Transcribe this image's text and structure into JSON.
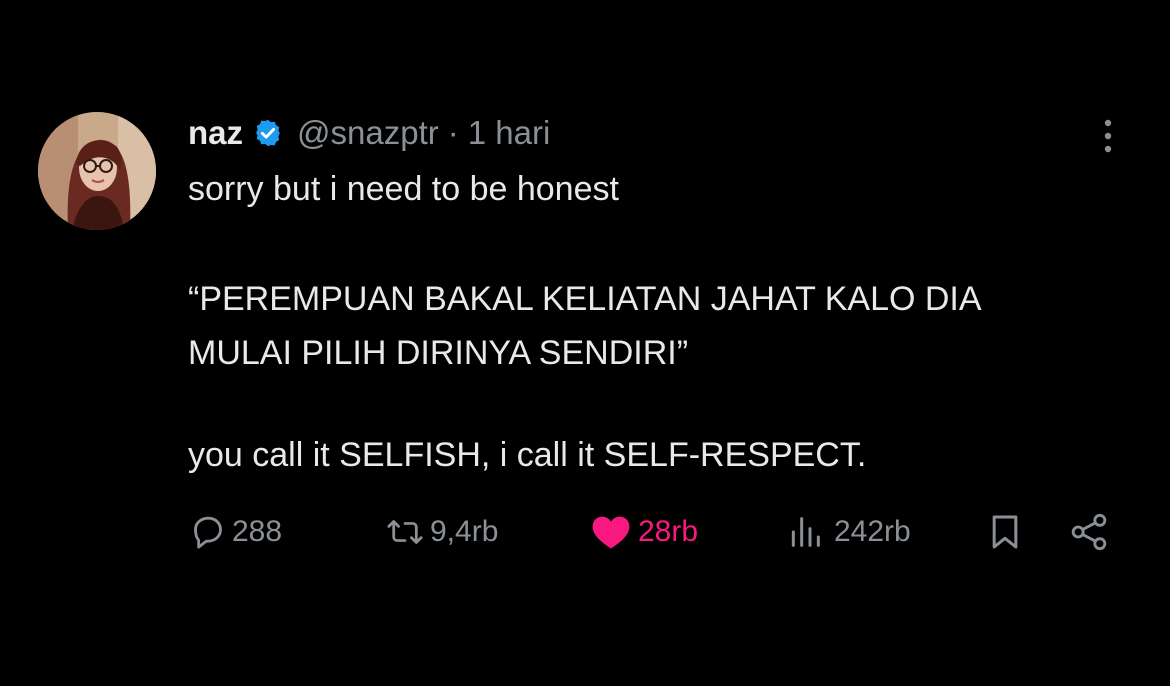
{
  "tweet": {
    "author": {
      "display_name": "naz",
      "handle": "@snazptr",
      "separator": "·",
      "time": "1 hari",
      "avatar_icon": "profile-photo"
    },
    "text_lines": [
      "sorry but i need to be honest",
      "“PEREMPUAN BAKAL KELIATAN JAHAT KALO DIA",
      "MULAI PILIH DIRINYA SENDIRI”",
      "you call it SELFISH, i call it SELF-RESPECT."
    ],
    "stats": {
      "replies": "288",
      "reposts": "9,4rb",
      "likes": "28rb",
      "views": "242rb"
    },
    "icons": {
      "reply": "speech-bubble-icon",
      "repost": "repost-arrows-icon",
      "like": "heart-icon",
      "views": "bar-chart-icon",
      "bookmark": "bookmark-icon",
      "share": "share-icon",
      "more": "vertical-dots-icon",
      "verified": "verified-badge-icon"
    },
    "colors": {
      "background": "#000000",
      "text": "#e7e9ea",
      "muted": "#8b9096",
      "like_active": "#f91880",
      "verified": "#1d9bf0"
    }
  }
}
